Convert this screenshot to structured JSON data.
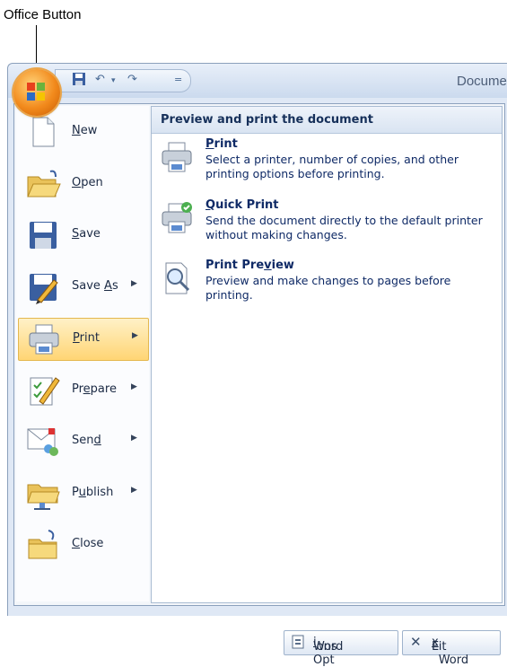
{
  "callout": {
    "label": "Office Button"
  },
  "window": {
    "title": "Docume"
  },
  "left_menu": [
    {
      "pre": "",
      "acc": "N",
      "post": "ew",
      "arrow": false,
      "active": false,
      "icon": "new-document-icon"
    },
    {
      "pre": "",
      "acc": "O",
      "post": "pen",
      "arrow": false,
      "active": false,
      "icon": "open-folder-icon"
    },
    {
      "pre": "",
      "acc": "S",
      "post": "ave",
      "arrow": false,
      "active": false,
      "icon": "save-icon"
    },
    {
      "pre": "Save ",
      "acc": "A",
      "post": "s",
      "arrow": true,
      "active": false,
      "icon": "save-as-icon"
    },
    {
      "pre": "",
      "acc": "P",
      "post": "rint",
      "arrow": true,
      "active": true,
      "icon": "printer-icon"
    },
    {
      "pre": "Pr",
      "acc": "e",
      "post": "pare",
      "arrow": true,
      "active": false,
      "icon": "prepare-icon"
    },
    {
      "pre": "Sen",
      "acc": "d",
      "post": "",
      "arrow": true,
      "active": false,
      "icon": "send-icon"
    },
    {
      "pre": "P",
      "acc": "u",
      "post": "blish",
      "arrow": true,
      "active": false,
      "icon": "publish-icon"
    },
    {
      "pre": "",
      "acc": "C",
      "post": "lose",
      "arrow": false,
      "active": false,
      "icon": "close-folder-icon"
    }
  ],
  "submenu": {
    "header": "Preview and print the document",
    "entries": [
      {
        "pre": "",
        "acc": "P",
        "post": "rint",
        "desc": "Select a printer, number of copies, and other printing options before printing.",
        "icon": "printer-icon"
      },
      {
        "pre": "",
        "acc": "Q",
        "post": "uick Print",
        "desc": "Send the document directly to the default printer without making changes.",
        "icon": "quick-print-icon"
      },
      {
        "pre": "Print Pre",
        "acc": "v",
        "post": "iew",
        "desc": "Preview and make changes to pages before printing.",
        "icon": "print-preview-icon"
      }
    ]
  },
  "footer": {
    "options": {
      "pre": "Word Opt",
      "acc": "i",
      "post": "ons"
    },
    "exit": {
      "pre": "E",
      "acc": "x",
      "post": "it Word"
    }
  }
}
